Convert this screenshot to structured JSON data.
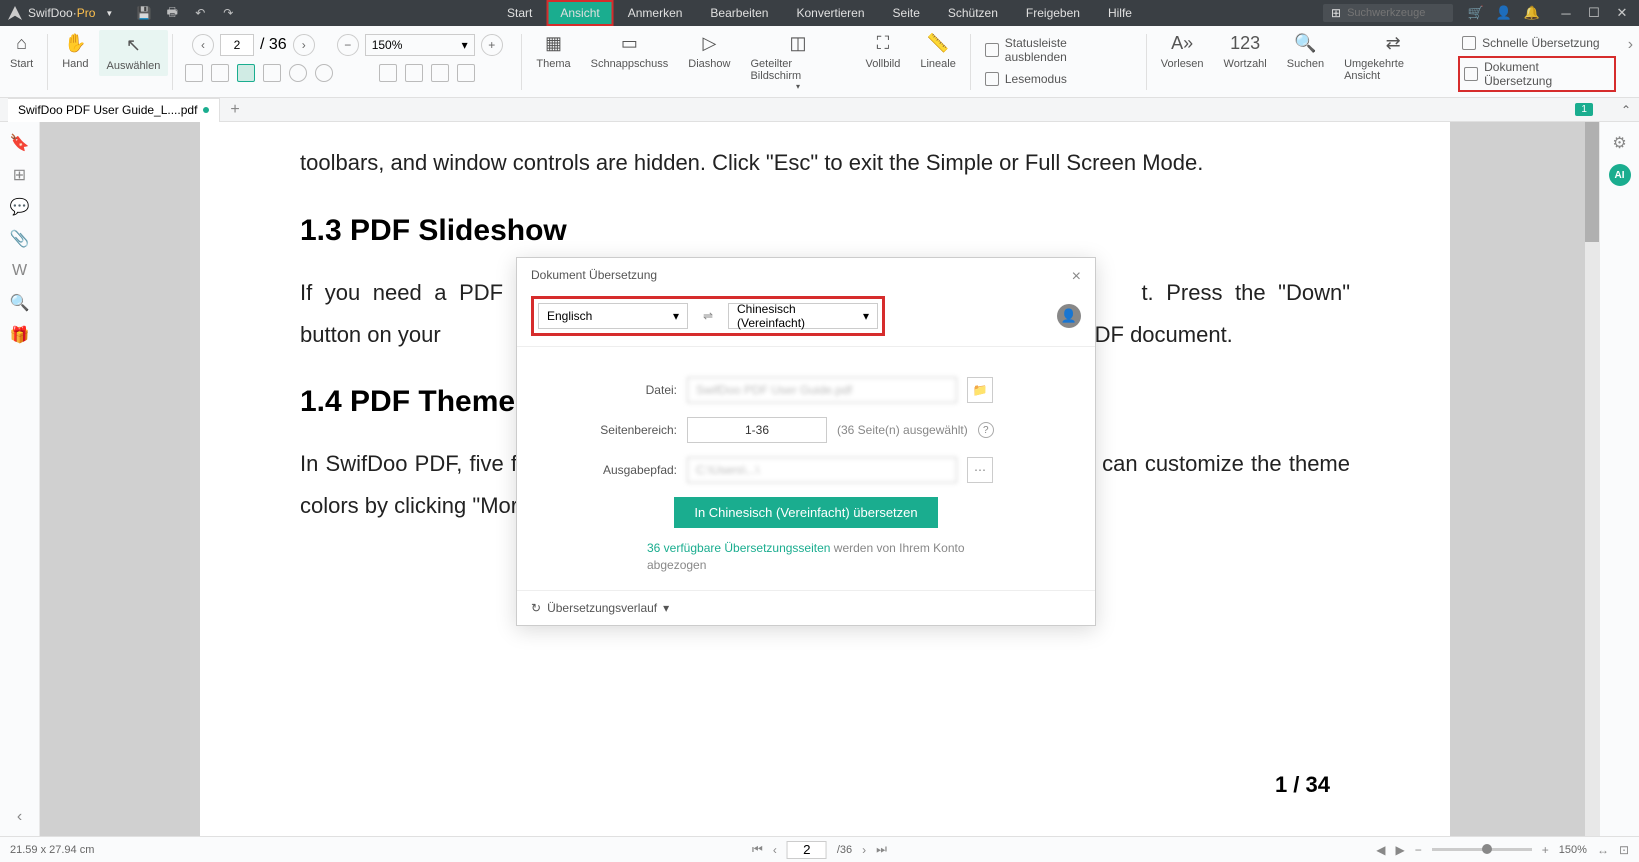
{
  "titlebar": {
    "app_name": "SwifDoo",
    "app_suffix": "Pro",
    "search_placeholder": "Suchwerkzeuge"
  },
  "menu": {
    "items": [
      "Start",
      "Ansicht",
      "Anmerken",
      "Bearbeiten",
      "Konvertieren",
      "Seite",
      "Schützen",
      "Freigeben",
      "Hilfe"
    ],
    "active_index": 1
  },
  "ribbon": {
    "start": "Start",
    "hand": "Hand",
    "select": "Auswählen",
    "page_current": "2",
    "page_total": "/ 36",
    "zoom": "150%",
    "theme": "Thema",
    "snapshot": "Schnappschuss",
    "slideshow": "Diashow",
    "split": "Geteilter Bildschirm",
    "fullscreen": "Vollbild",
    "rulers": "Lineale",
    "statusbar_hide": "Statusleiste ausblenden",
    "readmode": "Lesemodus",
    "readaloud": "Vorlesen",
    "wordcount": "Wortzahl",
    "search": "Suchen",
    "reverse_view": "Umgekehrte Ansicht",
    "quick_translate": "Schnelle Übersetzung",
    "doc_translate": "Dokument Übersetzung"
  },
  "tab": {
    "filename": "SwifDoo PDF User Guide_L....pdf",
    "badge": "1"
  },
  "document": {
    "para1": "toolbars, and window controls are hidden. Click \"Esc\" to exit the Simple or Full Screen Mode.",
    "h1": "1.3 PDF Slideshow",
    "para2a": "If you need a PDF pre",
    "para2b": "t. Press the \"Down\" button on your",
    "para2c": "gh the PDF document.",
    "h2": "1.4 PDF Theme C",
    "para3": "In SwifDoo PDF, five fu                                                                                                               nplicity, eye protection, and letter paper. Additionally, you can customize the theme colors by clicking \"More\".",
    "page_number": "1 / 34"
  },
  "dialog": {
    "title": "Dokument Übersetzung",
    "lang_from": "Englisch",
    "lang_to": "Chinesisch (Vereinfacht)",
    "file_label": "Datei:",
    "file_value": "SwifDoo PDF User Guide.pdf",
    "range_label": "Seitenbereich:",
    "range_value": "1-36",
    "range_hint": "(36 Seite(n) ausgewählt)",
    "output_label": "Ausgabepfad:",
    "output_value": "C:\\Users\\...\\",
    "translate_btn": "In Chinesisch (Vereinfacht) übersetzen",
    "credits_link": "36 verfügbare Übersetzungsseiten",
    "credits_text": " werden von Ihrem Konto abgezogen",
    "history": "Übersetzungsverlauf"
  },
  "statusbar": {
    "dimensions": "21.59 x 27.94 cm",
    "page_current": "2",
    "page_total": "/36",
    "zoom": "150%"
  }
}
